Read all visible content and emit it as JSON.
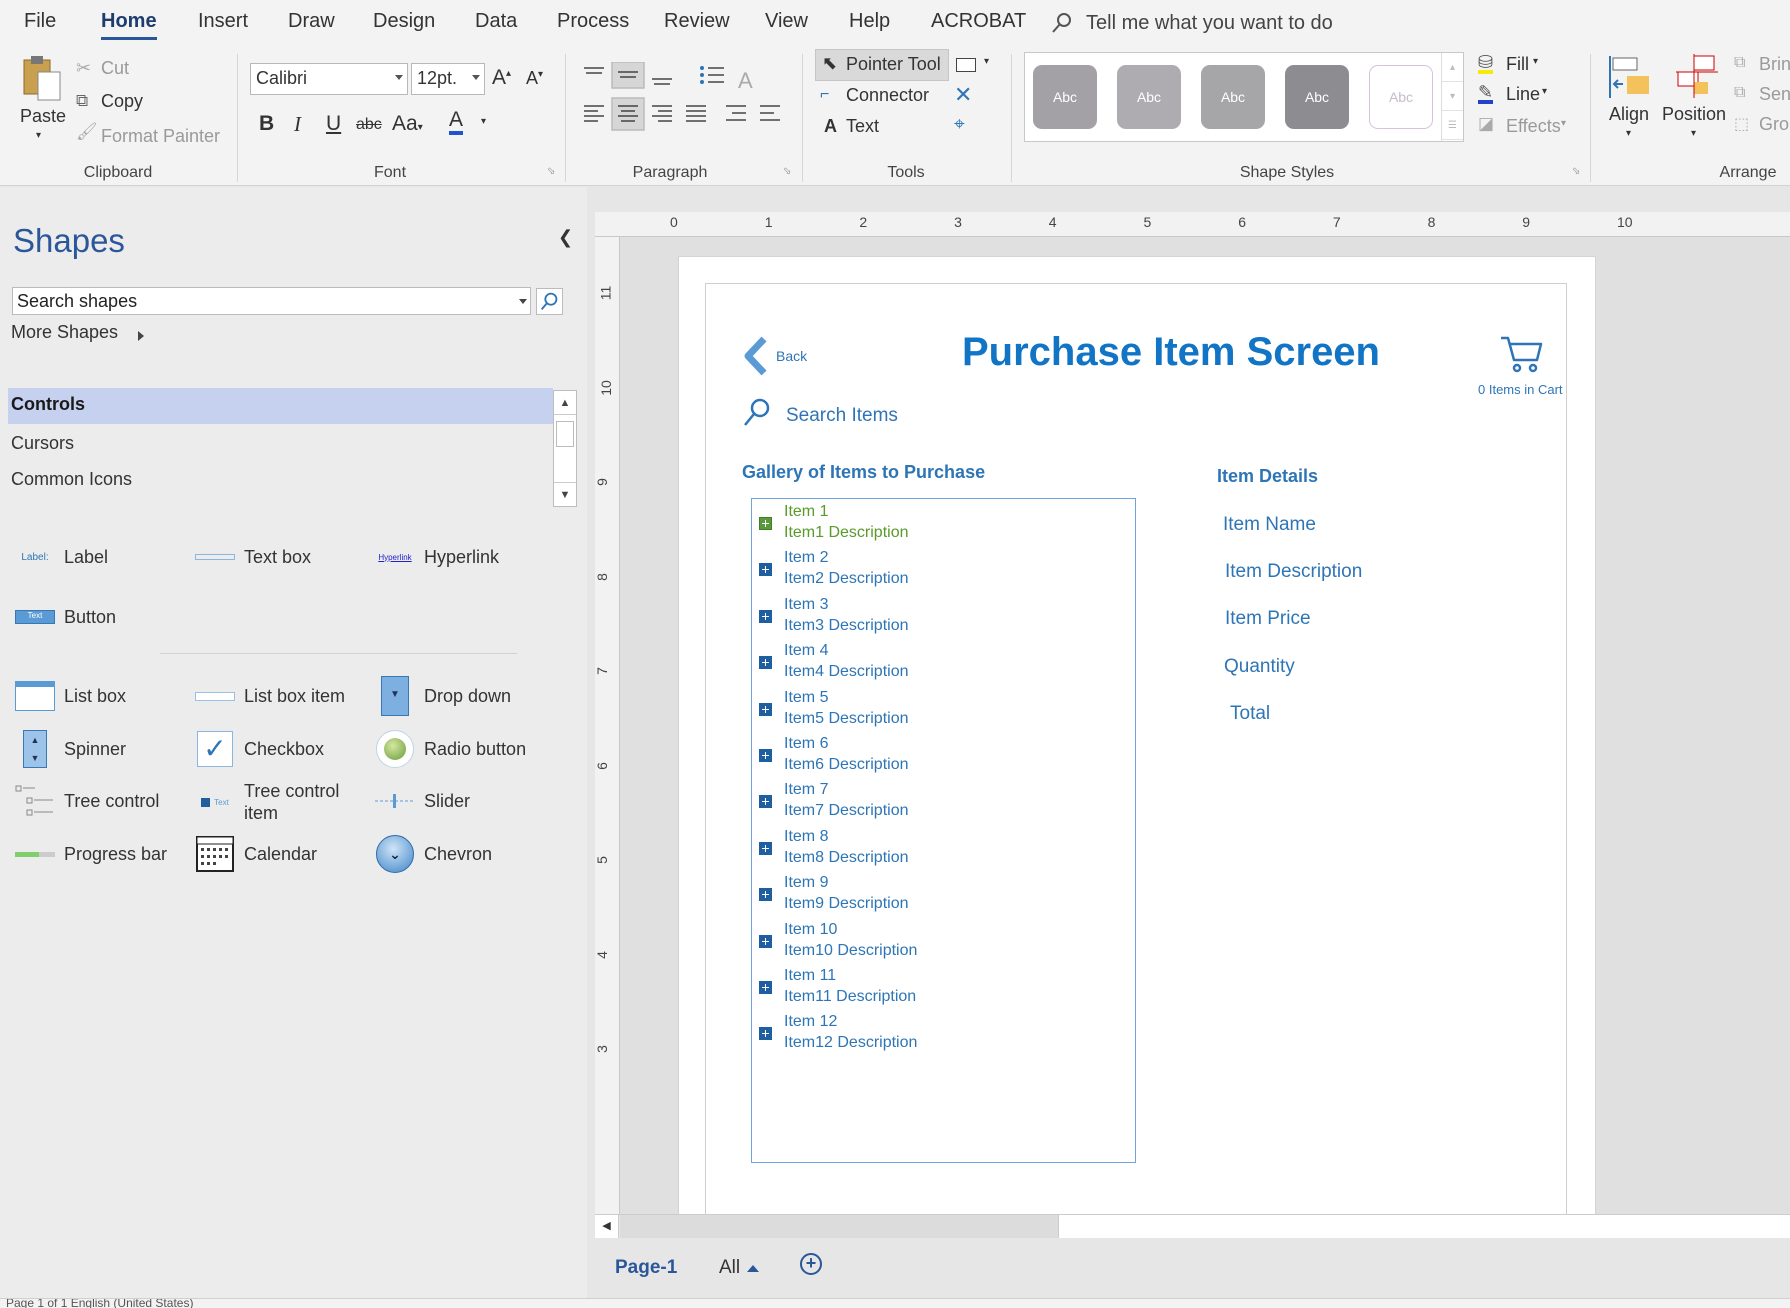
{
  "menu": [
    "File",
    "Home",
    "Insert",
    "Draw",
    "Design",
    "Data",
    "Process",
    "Review",
    "View",
    "Help",
    "ACROBAT"
  ],
  "tell_me": "Tell me what you want to do",
  "ribbon": {
    "clipboard": {
      "paste": "Paste",
      "cut": "Cut",
      "copy": "Copy",
      "format_painter": "Format Painter",
      "group": "Clipboard"
    },
    "font": {
      "family": "Calibri",
      "size": "12pt.",
      "group": "Font"
    },
    "paragraph": {
      "group": "Paragraph"
    },
    "tools": {
      "pointer": "Pointer Tool",
      "connector": "Connector",
      "text": "Text",
      "group": "Tools"
    },
    "shape_styles": {
      "swatches": [
        "Abc",
        "Abc",
        "Abc",
        "Abc",
        "Abc"
      ],
      "fill": "Fill",
      "line": "Line",
      "effects": "Effects",
      "group": "Shape Styles"
    },
    "arrange": {
      "align": "Align",
      "position": "Position",
      "bring": "Brin",
      "send": "Sen",
      "group_btn": "Gro",
      "group": "Arrange"
    }
  },
  "shapes_pane": {
    "title": "Shapes",
    "search_placeholder": "Search shapes",
    "more_shapes": "More Shapes",
    "stencils": [
      "Controls",
      "Cursors",
      "Common Icons"
    ],
    "items_top": [
      "Label",
      "Text box",
      "Hyperlink",
      "Button"
    ],
    "items": [
      "List box",
      "List box item",
      "Drop down",
      "Spinner",
      "Checkbox",
      "Radio button",
      "Tree control",
      "Tree control item",
      "Slider",
      "Progress bar",
      "Calendar",
      "Chevron"
    ],
    "icon_texts": {
      "label": "Label:",
      "hyperlink": "Hyperlink",
      "button": "Text",
      "tree_item": "Text"
    }
  },
  "ruler": {
    "h": [
      "0",
      "1",
      "2",
      "3",
      "4",
      "5",
      "6",
      "7",
      "8",
      "9",
      "10"
    ],
    "v": [
      "11",
      "10",
      "9",
      "8",
      "7",
      "6",
      "5",
      "4",
      "3"
    ]
  },
  "mockup": {
    "back": "Back",
    "title": "Purchase Item Screen",
    "cart": "0 Items in Cart",
    "search": "Search Items",
    "gallery_title": "Gallery of Items to Purchase",
    "gallery": [
      {
        "name": "Item 1",
        "desc": "Item1 Description"
      },
      {
        "name": "Item 2",
        "desc": "Item2 Description"
      },
      {
        "name": "Item 3",
        "desc": "Item3 Description"
      },
      {
        "name": "Item 4",
        "desc": "Item4 Description"
      },
      {
        "name": "Item 5",
        "desc": "Item5 Description"
      },
      {
        "name": "Item 6",
        "desc": "Item6 Description"
      },
      {
        "name": "Item 7",
        "desc": "Item7 Description"
      },
      {
        "name": "Item 8",
        "desc": "Item8 Description"
      },
      {
        "name": "Item 9",
        "desc": "Item9 Description"
      },
      {
        "name": "Item 10",
        "desc": "Item10 Description"
      },
      {
        "name": "Item 11",
        "desc": "Item11 Description"
      },
      {
        "name": "Item 12",
        "desc": "Item12 Description"
      }
    ],
    "details_title": "Item Details",
    "details": [
      "Item Name",
      "Item Description",
      "Item Price",
      "Quantity",
      "Total"
    ]
  },
  "tabs": {
    "page": "Page-1",
    "all": "All"
  },
  "status": "Page 1 of 1    English (United States)"
}
